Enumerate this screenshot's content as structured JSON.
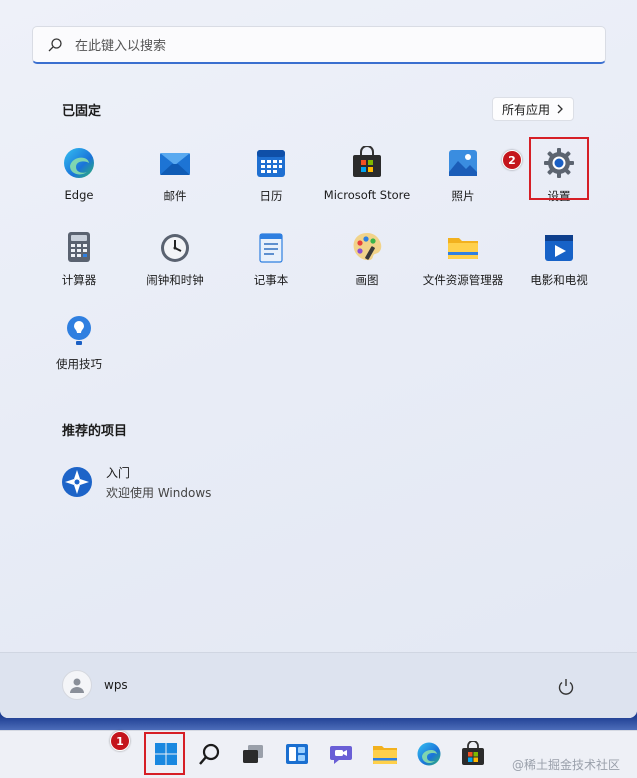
{
  "search": {
    "placeholder": "在此键入以搜索"
  },
  "pinned": {
    "title": "已固定",
    "all_apps_label": "所有应用",
    "apps": [
      {
        "label": "Edge",
        "icon": "edge-icon"
      },
      {
        "label": "邮件",
        "icon": "mail-icon"
      },
      {
        "label": "日历",
        "icon": "calendar-icon"
      },
      {
        "label": "Microsoft Store",
        "icon": "store-icon"
      },
      {
        "label": "照片",
        "icon": "photos-icon"
      },
      {
        "label": "设置",
        "icon": "settings-gear-icon"
      },
      {
        "label": "计算器",
        "icon": "calculator-icon"
      },
      {
        "label": "闹钟和时钟",
        "icon": "clock-icon"
      },
      {
        "label": "记事本",
        "icon": "notepad-icon"
      },
      {
        "label": "画图",
        "icon": "paint-icon"
      },
      {
        "label": "文件资源管理器",
        "icon": "folder-icon"
      },
      {
        "label": "电影和电视",
        "icon": "movies-icon"
      },
      {
        "label": "使用技巧",
        "icon": "tips-icon"
      }
    ]
  },
  "recommended": {
    "title": "推荐的项目",
    "items": [
      {
        "title": "入门",
        "subtitle": "欢迎使用 Windows",
        "icon": "get-started-icon"
      }
    ]
  },
  "annotations": {
    "badge_start": "1",
    "badge_settings": "2",
    "color": "#d61f26"
  },
  "user": {
    "name": "wps"
  },
  "taskbar": {
    "items": [
      "start-icon",
      "search-icon",
      "task-view-icon",
      "widgets-icon",
      "chat-icon",
      "file-explorer-icon",
      "edge-icon",
      "store-icon"
    ]
  },
  "watermark": "@稀土掘金技术社区",
  "colors": {
    "accent": "#3a6fcf",
    "annotation_red": "#d61f26"
  }
}
